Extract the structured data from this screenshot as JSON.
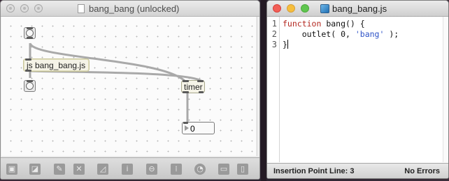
{
  "patcher": {
    "title": "bang_bang (unlocked)",
    "objects": {
      "js_label": "js bang_bang.js",
      "timer_label": "timer",
      "number_value": "0"
    },
    "toolbar_icons": [
      "lock-icon",
      "presentation-icon",
      "paint-icon",
      "object-box-icon",
      "chart-icon",
      "info-icon",
      "slider-icon",
      "grid-icon",
      "clock-icon",
      "split-view-icon",
      "sidebar-icon"
    ]
  },
  "editor": {
    "title": "bang_bang.js",
    "line_numbers": [
      "1",
      "2",
      "3"
    ],
    "code": {
      "line1_kw": "function",
      "line1_rest": " bang() {",
      "line2_pre": "    outlet( 0, ",
      "line2_str": "'bang'",
      "line2_post": " );",
      "line3": "}"
    },
    "status": {
      "left": "Insertion Point Line: 3",
      "right": "No Errors"
    }
  },
  "colors": {
    "keyword": "#b3261e",
    "string": "#2f54c8",
    "close": "#f25f57",
    "minimize": "#f6be3c",
    "zoom": "#5fc64f"
  }
}
